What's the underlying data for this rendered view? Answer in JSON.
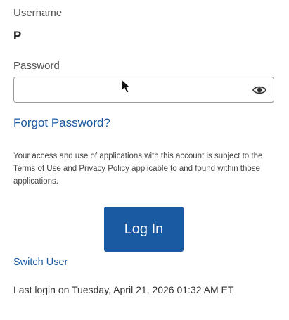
{
  "form": {
    "username_label": "Username",
    "username_value": "P",
    "password_label": "Password",
    "password_value": "",
    "password_toggle_icon": "eye-icon",
    "forgot_password": "Forgot Password?",
    "notice": "Your access and use of applications with this account is subject to the Terms of Use and Privacy Policy applicable to and found within those applications.",
    "login_button": "Log In",
    "switch_user": "Switch User",
    "last_login": "Last login on Tuesday, April 21, 2026 01:32 AM ET"
  },
  "colors": {
    "accent": "#1a5aa3",
    "background": "#ffffff",
    "border": "#9a9a9a"
  }
}
